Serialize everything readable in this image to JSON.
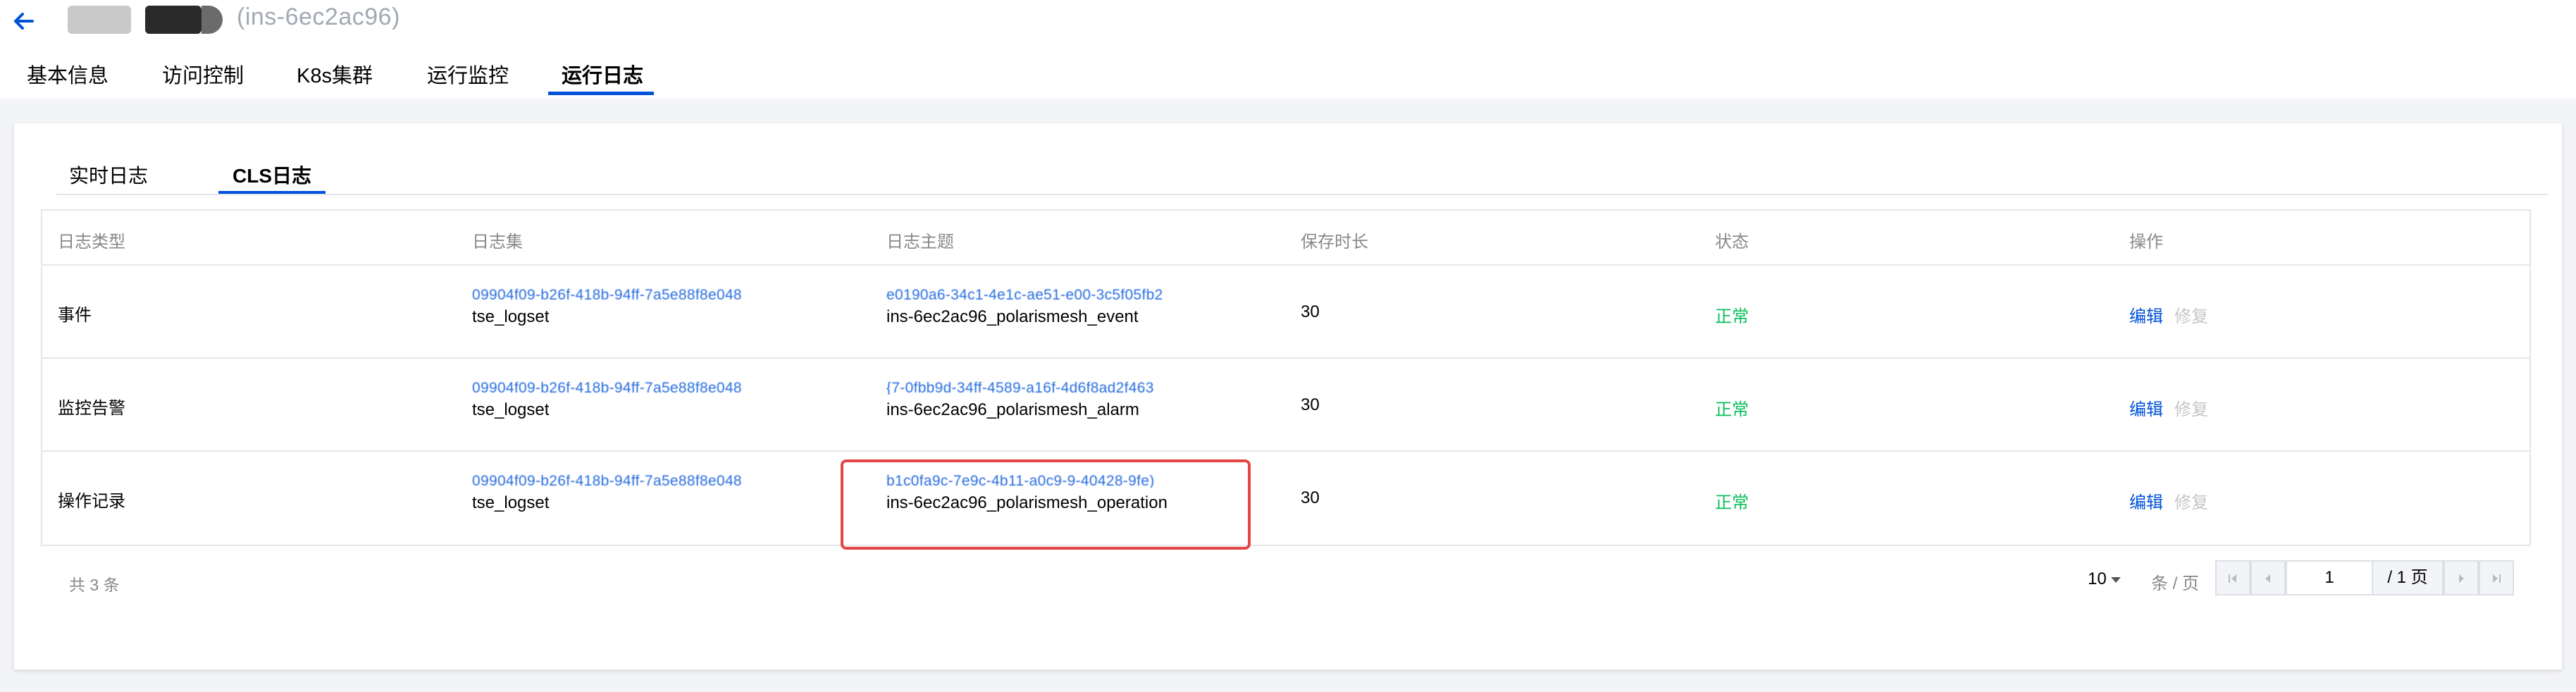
{
  "header": {
    "instance_id": "(ins-6ec2ac96)",
    "tabs": [
      {
        "label": "基本信息"
      },
      {
        "label": "访问控制"
      },
      {
        "label": "K8s集群"
      },
      {
        "label": "运行监控"
      },
      {
        "label": "运行日志",
        "active": true
      }
    ]
  },
  "subtabs": [
    {
      "label": "实时日志"
    },
    {
      "label": "CLS日志",
      "active": true
    }
  ],
  "table": {
    "columns": [
      "日志类型",
      "日志集",
      "日志主题",
      "保存时长",
      "状态",
      "操作"
    ],
    "rows": [
      {
        "type": "事件",
        "logset_id": "09904f09-b26f-418b-94ff-7a5e88f8e048",
        "logset_name": "tse_logset",
        "topic_id": "e0190a6-34c1-4e1c-ae51-e00-3c5f05fb2",
        "topic_name": "ins-6ec2ac96_polarismesh_event",
        "retention": "30",
        "status": "正常",
        "edit": "编辑",
        "repair": "修复"
      },
      {
        "type": "监控告警",
        "logset_id": "09904f09-b26f-418b-94ff-7a5e88f8e048",
        "logset_name": "tse_logset",
        "topic_id": "{7-0fbb9d-34ff-4589-a16f-4d6f8ad2f463",
        "topic_name": "ins-6ec2ac96_polarismesh_alarm",
        "retention": "30",
        "status": "正常",
        "edit": "编辑",
        "repair": "修复"
      },
      {
        "type": "操作记录",
        "logset_id": "09904f09-b26f-418b-94ff-7a5e88f8e048",
        "logset_name": "tse_logset",
        "topic_id": "b1c0fa9c-7e9c-4b11-a0c9-9-40428-9fe)",
        "topic_name": "ins-6ec2ac96_polarismesh_operation",
        "retention": "30",
        "status": "正常",
        "edit": "编辑",
        "repair": "修复"
      }
    ]
  },
  "footer": {
    "total": "共 3 条",
    "page_size": "10",
    "per_page": "条 / 页",
    "current_page": "1",
    "total_pages": "/ 1 页"
  },
  "colors": {
    "accent": "#0052d9",
    "status_ok": "#0abf5b",
    "highlight": "#e54545"
  }
}
